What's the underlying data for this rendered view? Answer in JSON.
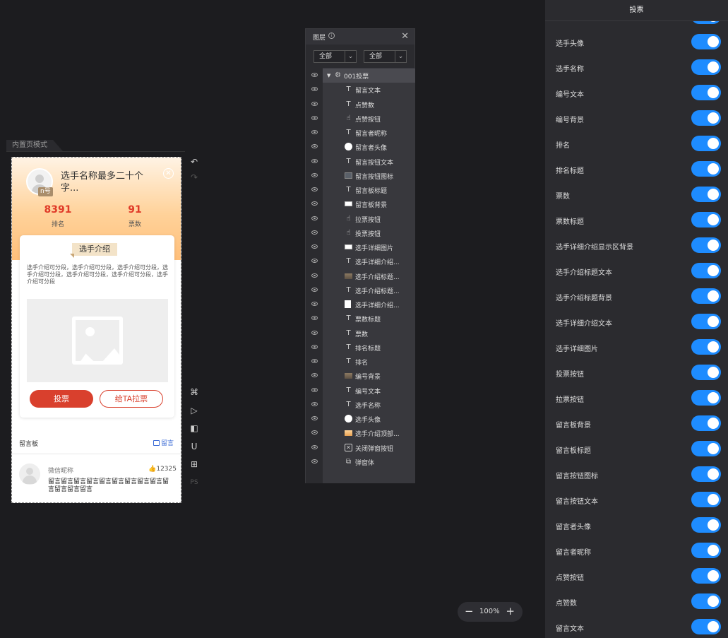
{
  "canvas": {
    "mode_label": "内置页模式"
  },
  "preview": {
    "badge": "n号",
    "name": "选手名称最多二十个字...",
    "rank_value": "8391",
    "rank_label": "排名",
    "votes_value": "91",
    "votes_label": "票数",
    "intro_tag": "选手介绍",
    "intro_text": "选手介绍可分段，选手介绍可分段，选手介绍可分段，选手介绍可分段，选手介绍可分段，选手介绍可分段，选手介绍可分段",
    "vote_button": "投票",
    "pull_button": "给TA拉票",
    "board_title": "留言板",
    "board_button": "留言",
    "comment": {
      "nickname": "微信昵称",
      "likes": "12325",
      "text": "留言留言留言留言留言留言留言留言留言留言留言留言留言"
    }
  },
  "tools": [
    "undo-icon",
    "redo-icon",
    "command-icon",
    "play-icon",
    "format-painter-icon",
    "magnet-icon",
    "grid-icon"
  ],
  "tools_ps": "PS",
  "layers": {
    "title": "图层",
    "filter1": "全部",
    "filter2": "全部",
    "root": "001投票",
    "items": [
      {
        "icon": "text",
        "label": "留言文本"
      },
      {
        "icon": "text",
        "label": "点赞数"
      },
      {
        "icon": "click",
        "label": "点赞按钮"
      },
      {
        "icon": "text",
        "label": "留言者昵称"
      },
      {
        "icon": "circle",
        "label": "留言者头像"
      },
      {
        "icon": "text",
        "label": "留言按钮文本"
      },
      {
        "icon": "gray",
        "label": "留言按钮图标"
      },
      {
        "icon": "text",
        "label": "留言板标题"
      },
      {
        "icon": "rect",
        "label": "留言板背景"
      },
      {
        "icon": "click",
        "label": "拉票按钮"
      },
      {
        "icon": "click",
        "label": "投票按钮"
      },
      {
        "icon": "rect",
        "label": "选手详细图片"
      },
      {
        "icon": "text",
        "label": "选手详细介绍..."
      },
      {
        "icon": "brown",
        "label": "选手介绍标题..."
      },
      {
        "icon": "text",
        "label": "选手介绍标题..."
      },
      {
        "icon": "white",
        "label": "选手详细介绍..."
      },
      {
        "icon": "text",
        "label": "票数标题"
      },
      {
        "icon": "text",
        "label": "票数"
      },
      {
        "icon": "text",
        "label": "排名标题"
      },
      {
        "icon": "text",
        "label": "排名"
      },
      {
        "icon": "brown",
        "label": "编号背景"
      },
      {
        "icon": "text",
        "label": "编号文本"
      },
      {
        "icon": "text",
        "label": "选手名称"
      },
      {
        "icon": "circle",
        "label": "选手头像"
      },
      {
        "icon": "orange",
        "label": "选手介绍顶部..."
      },
      {
        "icon": "xbox",
        "label": "关闭弹窗按钮"
      },
      {
        "icon": "window",
        "label": "弹窗体"
      }
    ]
  },
  "zoom": {
    "minus": "−",
    "value": "100%",
    "plus": "+"
  },
  "settings": {
    "title": "投票",
    "items": [
      "选手头像",
      "选手名称",
      "编号文本",
      "编号背景",
      "排名",
      "排名标题",
      "票数",
      "票数标题",
      "选手详细介绍显示区背景",
      "选手介绍标题文本",
      "选手介绍标题背景",
      "选手详细介绍文本",
      "选手详细图片",
      "投票按钮",
      "拉票按钮",
      "留言板背景",
      "留言板标题",
      "留言按钮图标",
      "留言按钮文本",
      "留言者头像",
      "留言者昵称",
      "点赞按钮",
      "点赞数",
      "留言文本"
    ]
  },
  "colors": {
    "accent": "#1e8cff",
    "vote_red": "#d9402d",
    "background": "#1c1c1f"
  }
}
